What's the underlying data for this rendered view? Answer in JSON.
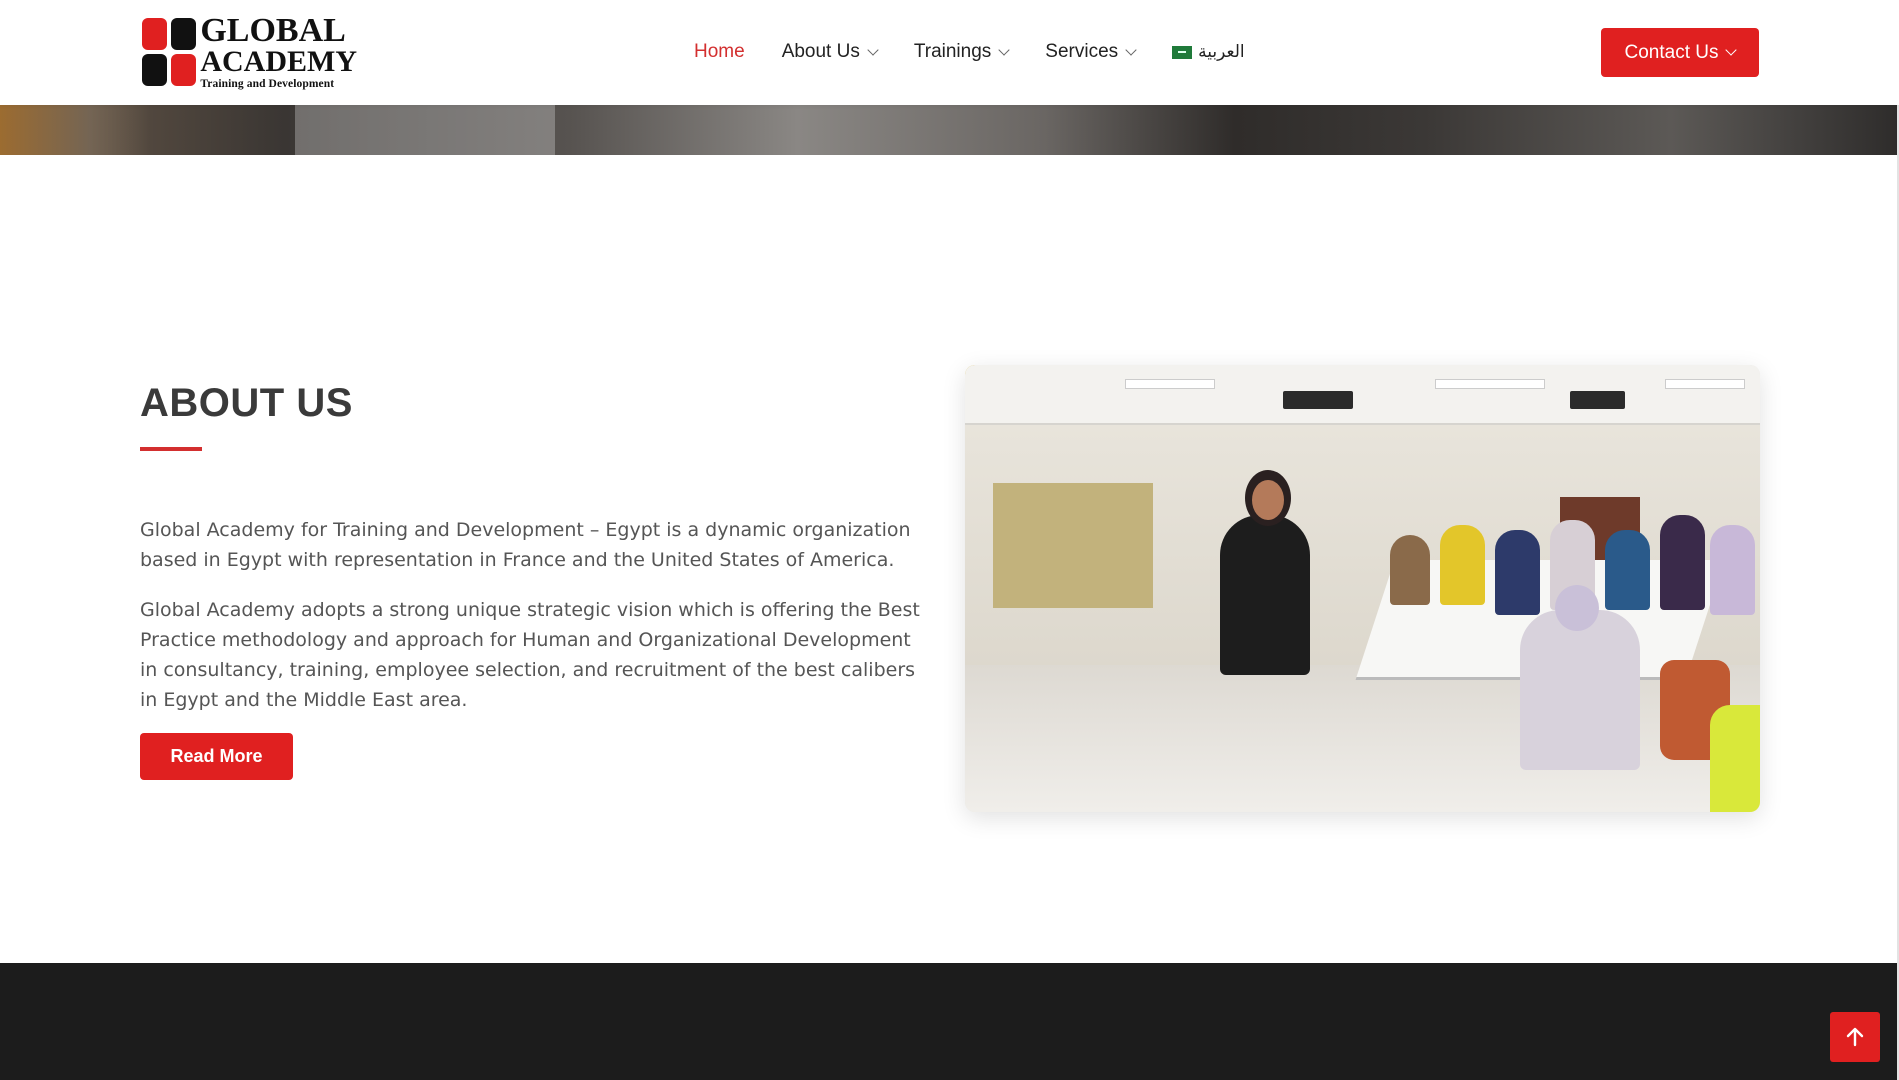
{
  "header": {
    "logo": {
      "line1": "GLOBAL",
      "line2": "ACADEMY",
      "line3": "Training and Development"
    },
    "nav": [
      {
        "label": "Home",
        "active": true,
        "has_dropdown": false
      },
      {
        "label": "About Us",
        "active": false,
        "has_dropdown": true
      },
      {
        "label": "Trainings",
        "active": false,
        "has_dropdown": true
      },
      {
        "label": "Services",
        "active": false,
        "has_dropdown": true
      }
    ],
    "language": {
      "label": "العربية",
      "icon": "saudi-flag-icon"
    },
    "contact_button": {
      "label": "Contact Us",
      "has_dropdown": true
    }
  },
  "about": {
    "title": "ABOUT US",
    "paragraphs": [
      "Global Academy for Training and Development – Egypt is a dynamic organization based in Egypt with representation in France and the United States of America.",
      "Global Academy adopts a strong unique strategic vision which is offering the Best Practice methodology and approach for Human and Organizational Development in consultancy, training, employee selection, and recruitment of the best calibers in Egypt and the Middle East area."
    ],
    "read_more_label": "Read More",
    "image": "classroom-training-photo"
  },
  "scroll_top": {
    "icon": "arrow-up-icon"
  },
  "colors": {
    "accent": "#e02020",
    "active_nav": "#d32f2f",
    "footer_bg": "#1c1c1c",
    "heading": "#3a3a3a",
    "body_text": "#555555"
  }
}
